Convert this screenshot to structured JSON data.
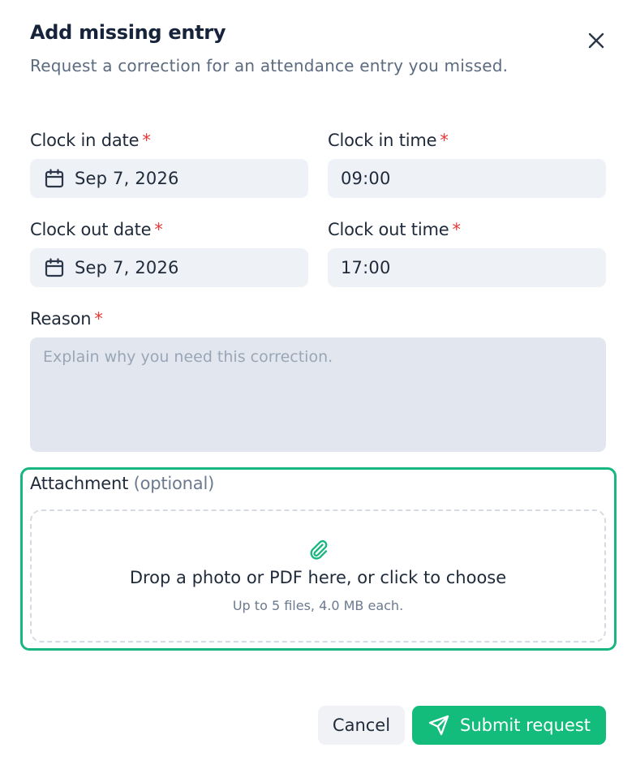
{
  "modal": {
    "title": "Add missing entry",
    "subtitle": "Request a correction for an attendance entry you missed.",
    "close_icon": "close-icon"
  },
  "form": {
    "required_mark": "*",
    "clock_in_date": {
      "label": "Clock in date",
      "value": "Sep 7, 2026",
      "icon": "calendar-icon"
    },
    "clock_in_time": {
      "label": "Clock in time",
      "value": "09:00"
    },
    "clock_out_date": {
      "label": "Clock out date",
      "value": "Sep 7, 2026",
      "icon": "calendar-icon"
    },
    "clock_out_time": {
      "label": "Clock out time",
      "value": "17:00"
    },
    "reason": {
      "label": "Reason",
      "placeholder": "Explain why you need this correction.",
      "value": ""
    },
    "attachment": {
      "label": "Attachment",
      "optional": "(optional)",
      "icon": "paperclip-icon",
      "drop_text": "Drop a photo or PDF here, or click to choose",
      "hint": "Up to 5 files, 4.0 MB each."
    }
  },
  "actions": {
    "cancel_label": "Cancel",
    "submit_label": "Submit request",
    "submit_icon": "send-icon"
  },
  "colors": {
    "accent": "#14bc7c",
    "required": "#e53935",
    "field_bg": "#eef1f6"
  }
}
